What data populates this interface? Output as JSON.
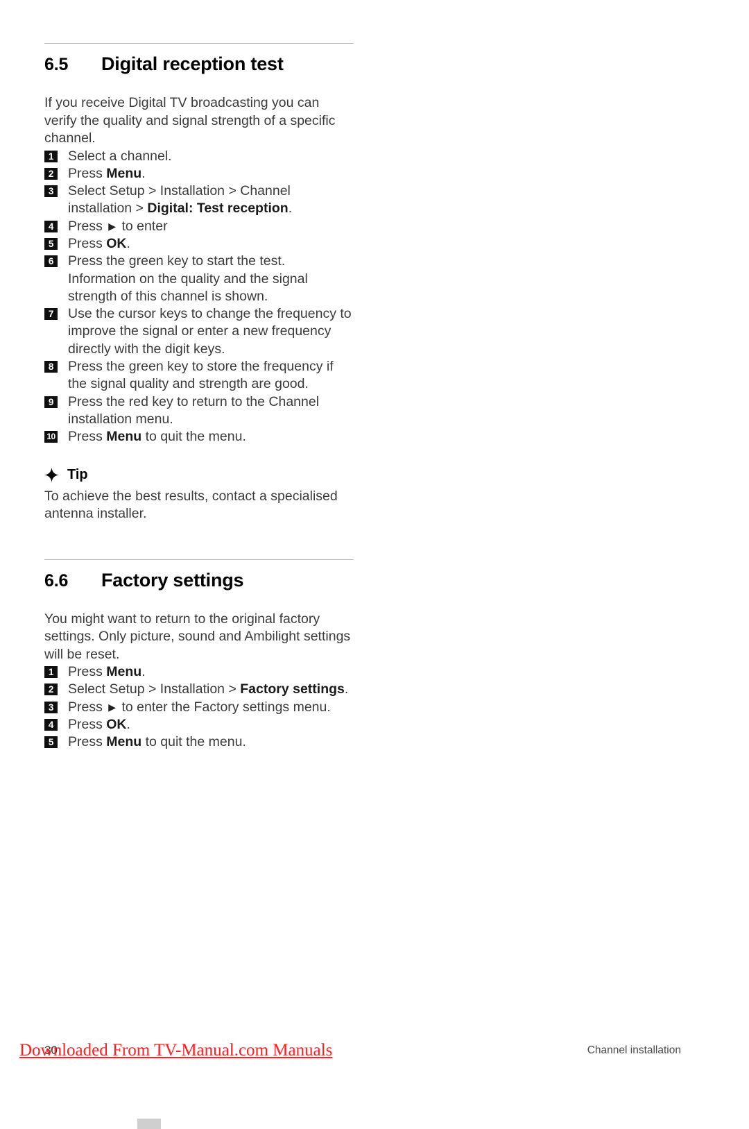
{
  "sections": [
    {
      "number": "6.5",
      "title": "Digital reception test",
      "intro": "If you receive Digital TV broadcasting you can verify the quality and signal strength of a specific channel.",
      "steps": [
        {
          "n": "1",
          "text": "Select a channel."
        },
        {
          "n": "2",
          "pre": "Press ",
          "bold": "Menu",
          "post": "."
        },
        {
          "n": "3",
          "pre": "Select Setup > Installation > Channel installation > ",
          "bold": "Digital: Test reception",
          "post": "."
        },
        {
          "n": "4",
          "pre": "Press ",
          "arrow": "▶",
          "post": " to enter"
        },
        {
          "n": "5",
          "pre": "Press ",
          "bold": "OK",
          "post": "."
        },
        {
          "n": "6",
          "text": "Press the green key to start the test. Information on the quality and the signal strength of this channel is shown."
        },
        {
          "n": "7",
          "text": "Use the cursor keys to change the frequency to improve the signal or enter a new frequency directly with the digit keys."
        },
        {
          "n": "8",
          "text": "Press the green key to store the frequency if the signal quality and strength are good."
        },
        {
          "n": "9",
          "text": "Press the red key to return to the Channel installation menu."
        },
        {
          "n": "10",
          "pre": "Press ",
          "bold": "Menu",
          "post": " to quit the menu."
        }
      ],
      "tip": {
        "icon": "star-burst-icon",
        "label": "Tip",
        "body": "To achieve the best results, contact a specialised antenna installer."
      }
    },
    {
      "number": "6.6",
      "title": "Factory settings",
      "intro": "You might want to return to the original factory settings. Only picture, sound and Ambilight settings will be reset.",
      "steps": [
        {
          "n": "1",
          "pre": "Press ",
          "bold": "Menu",
          "post": "."
        },
        {
          "n": "2",
          "pre": "Select Setup > Installation > ",
          "bold": "Factory settings",
          "post": "."
        },
        {
          "n": "3",
          "pre": "Press ",
          "arrow": "▶",
          "post": " to enter the Factory settings menu."
        },
        {
          "n": "4",
          "pre": "Press ",
          "bold": "OK",
          "post": "."
        },
        {
          "n": "5",
          "pre": "Press ",
          "bold": "Menu",
          "post": " to quit the menu."
        }
      ]
    }
  ],
  "footer": {
    "watermark": "Downloaded From TV-Manual.com Manuals",
    "page_number": "30",
    "chapter": "Channel installation"
  },
  "colors": {
    "watermark_red": "#fc2020",
    "badge_black": "#100f0f",
    "rule_gray": "#b9b9b9",
    "body_gray": "#3b3b3b"
  }
}
